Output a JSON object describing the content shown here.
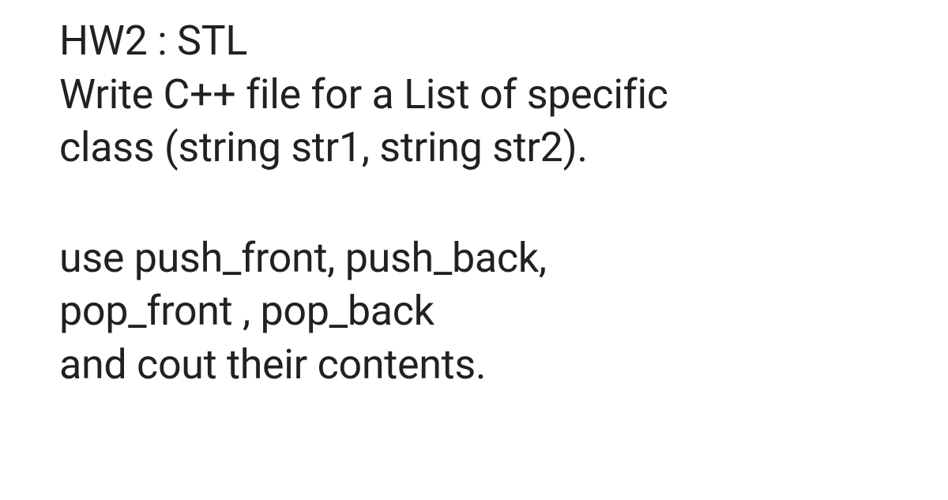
{
  "paragraphs": {
    "p1_line1": "HW2 : STL",
    "p1_line2": "Write C++ file for a List of specific",
    "p1_line3": "class (string str1, string str2).",
    "p2_line1": "use push_front, push_back,",
    "p2_line2": "pop_front , pop_back",
    "p2_line3": "and cout their contents."
  }
}
